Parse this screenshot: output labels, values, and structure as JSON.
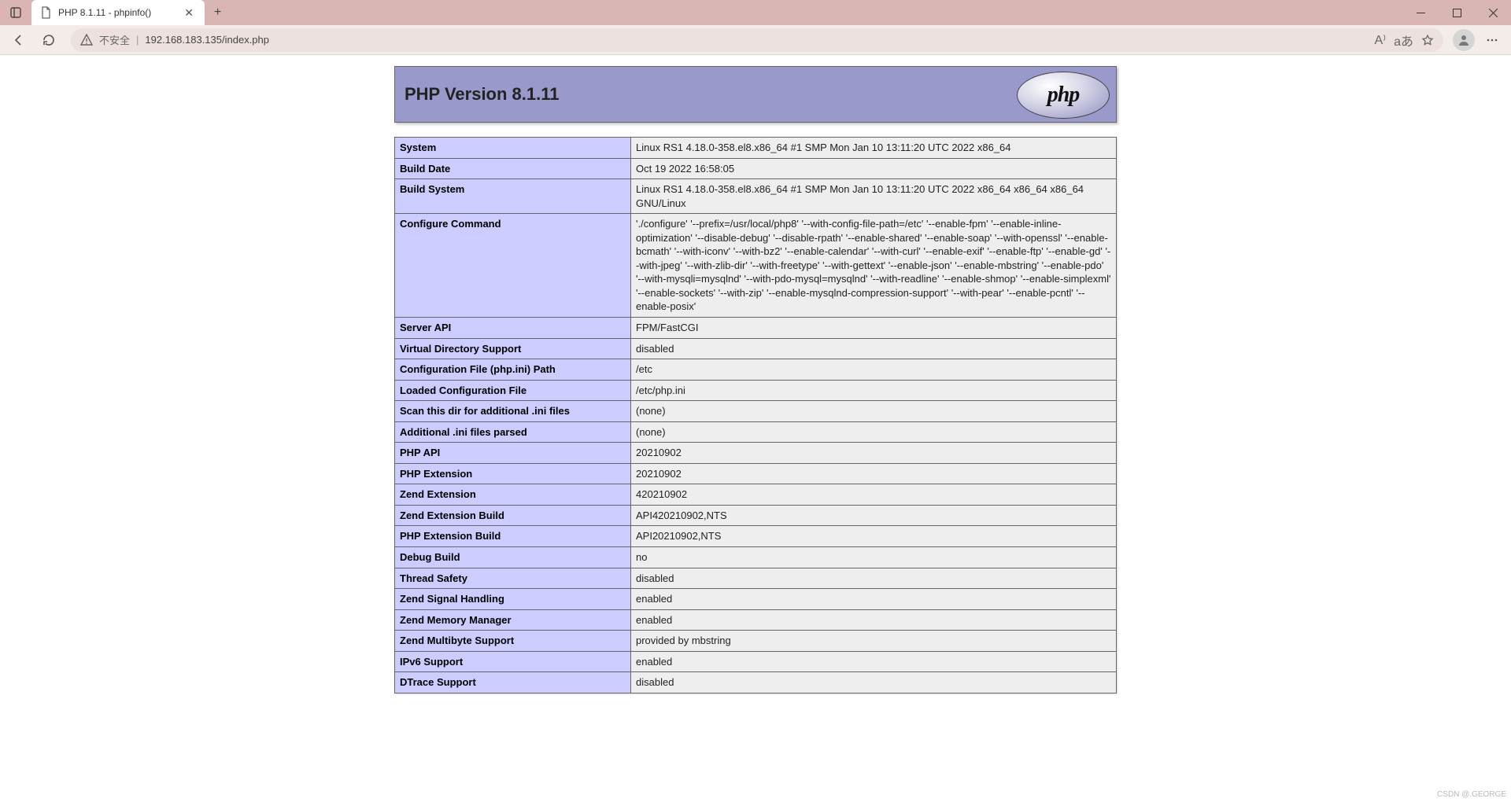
{
  "browser": {
    "tab_title": "PHP 8.1.11 - phpinfo()",
    "security_text": "不安全",
    "url": "192.168.183.135/index.php",
    "read_aloud_label": "A⁾",
    "translate_label": "aあ"
  },
  "page": {
    "header_title": "PHP Version 8.1.11",
    "logo_text": "php"
  },
  "rows": [
    {
      "k": "System",
      "v": "Linux RS1 4.18.0-358.el8.x86_64 #1 SMP Mon Jan 10 13:11:20 UTC 2022 x86_64"
    },
    {
      "k": "Build Date",
      "v": "Oct 19 2022 16:58:05"
    },
    {
      "k": "Build System",
      "v": "Linux RS1 4.18.0-358.el8.x86_64 #1 SMP Mon Jan 10 13:11:20 UTC 2022 x86_64 x86_64 x86_64 GNU/Linux"
    },
    {
      "k": "Configure Command",
      "v": "'./configure' '--prefix=/usr/local/php8' '--with-config-file-path=/etc' '--enable-fpm' '--enable-inline-optimization' '--disable-debug' '--disable-rpath' '--enable-shared' '--enable-soap' '--with-openssl' '--enable-bcmath' '--with-iconv' '--with-bz2' '--enable-calendar' '--with-curl' '--enable-exif' '--enable-ftp' '--enable-gd' '--with-jpeg' '--with-zlib-dir' '--with-freetype' '--with-gettext' '--enable-json' '--enable-mbstring' '--enable-pdo' '--with-mysqli=mysqlnd' '--with-pdo-mysql=mysqlnd' '--with-readline' '--enable-shmop' '--enable-simplexml' '--enable-sockets' '--with-zip' '--enable-mysqlnd-compression-support' '--with-pear' '--enable-pcntl' '--enable-posix'"
    },
    {
      "k": "Server API",
      "v": "FPM/FastCGI"
    },
    {
      "k": "Virtual Directory Support",
      "v": "disabled"
    },
    {
      "k": "Configuration File (php.ini) Path",
      "v": "/etc"
    },
    {
      "k": "Loaded Configuration File",
      "v": "/etc/php.ini"
    },
    {
      "k": "Scan this dir for additional .ini files",
      "v": "(none)"
    },
    {
      "k": "Additional .ini files parsed",
      "v": "(none)"
    },
    {
      "k": "PHP API",
      "v": "20210902"
    },
    {
      "k": "PHP Extension",
      "v": "20210902"
    },
    {
      "k": "Zend Extension",
      "v": "420210902"
    },
    {
      "k": "Zend Extension Build",
      "v": "API420210902,NTS"
    },
    {
      "k": "PHP Extension Build",
      "v": "API20210902,NTS"
    },
    {
      "k": "Debug Build",
      "v": "no"
    },
    {
      "k": "Thread Safety",
      "v": "disabled"
    },
    {
      "k": "Zend Signal Handling",
      "v": "enabled"
    },
    {
      "k": "Zend Memory Manager",
      "v": "enabled"
    },
    {
      "k": "Zend Multibyte Support",
      "v": "provided by mbstring"
    },
    {
      "k": "IPv6 Support",
      "v": "enabled"
    },
    {
      "k": "DTrace Support",
      "v": "disabled"
    }
  ],
  "watermark": "CSDN @.GEORGE"
}
